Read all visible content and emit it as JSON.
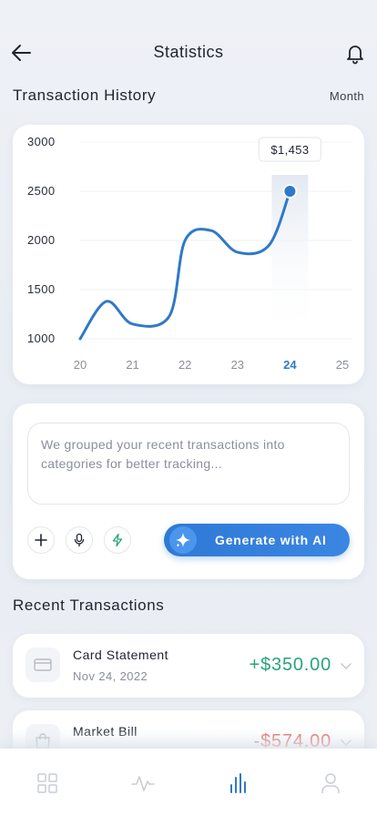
{
  "header": {
    "title": "Statistics",
    "back_icon": "arrow-left-icon",
    "bell_icon": "bell-icon"
  },
  "history": {
    "title": "Transaction History",
    "period": "Month"
  },
  "chart_data": {
    "type": "line",
    "x": [
      20,
      20.5,
      21,
      21.7,
      22,
      22.5,
      23,
      23.6,
      24
    ],
    "values": [
      1000,
      1380,
      1150,
      1230,
      2000,
      2100,
      1880,
      1950,
      2500
    ],
    "x_ticks": [
      "20",
      "21",
      "22",
      "23",
      "24",
      "25"
    ],
    "y_ticks": [
      "3000",
      "2500",
      "2000",
      "1500",
      "1000"
    ],
    "xlim": [
      20,
      25
    ],
    "ylim": [
      1000,
      3000
    ],
    "highlight_x": "24",
    "tooltip": "$1,453",
    "grid": true,
    "colors": {
      "line": "#2f79c8",
      "highlight": "#2f79c8",
      "tick": "#8a8f99"
    }
  },
  "ai": {
    "text": "We grouped your recent transactions into categories for better tracking...",
    "generate_label": "Generate with AI",
    "add_icon": "plus-icon",
    "mic_icon": "microphone-icon",
    "bolt_icon": "lightning-icon",
    "sparkle_icon": "sparkle-icon"
  },
  "recent": {
    "title": "Recent Transactions",
    "items": [
      {
        "title": "Card Statement",
        "date": "Nov 24, 2022",
        "amount": "+$350.00",
        "icon": "card-icon"
      },
      {
        "title": "Market Bill",
        "date": "",
        "amount": "-$574.00",
        "icon": "bag-icon"
      }
    ]
  },
  "nav": {
    "items": [
      "grid-icon",
      "activity-icon",
      "bar-chart-icon",
      "user-icon"
    ],
    "active": "bar-chart-icon"
  }
}
